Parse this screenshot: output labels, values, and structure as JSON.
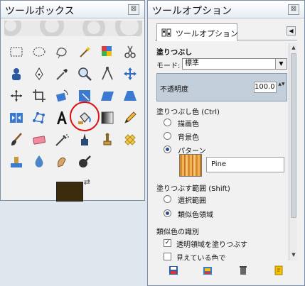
{
  "toolbox": {
    "title": "ツールボックス",
    "close_label": "⊠",
    "tools": [
      {
        "name": "rect-select-icon"
      },
      {
        "name": "ellipse-select-icon"
      },
      {
        "name": "free-select-icon"
      },
      {
        "name": "fuzzy-select-icon"
      },
      {
        "name": "color-select-icon"
      },
      {
        "name": "scissors-select-icon"
      },
      {
        "name": "foreground-select-icon"
      },
      {
        "name": "paths-icon"
      },
      {
        "name": "color-picker-icon"
      },
      {
        "name": "zoom-icon"
      },
      {
        "name": "measure-icon"
      },
      {
        "name": "move-icon"
      },
      {
        "name": "align-icon"
      },
      {
        "name": "crop-icon"
      },
      {
        "name": "rotate-icon"
      },
      {
        "name": "scale-icon"
      },
      {
        "name": "shear-icon"
      },
      {
        "name": "perspective-icon"
      },
      {
        "name": "flip-icon"
      },
      {
        "name": "cage-icon"
      },
      {
        "name": "text-icon"
      },
      {
        "name": "bucket-fill-icon"
      },
      {
        "name": "blend-icon"
      },
      {
        "name": "pencil-icon"
      },
      {
        "name": "paintbrush-icon"
      },
      {
        "name": "eraser-icon"
      },
      {
        "name": "airbrush-icon"
      },
      {
        "name": "ink-icon"
      },
      {
        "name": "clone-icon"
      },
      {
        "name": "heal-icon"
      },
      {
        "name": "perspective-clone-icon"
      },
      {
        "name": "blur-icon"
      },
      {
        "name": "smudge-icon"
      },
      {
        "name": "dodge-burn-icon"
      }
    ],
    "fg_color": "#3a2c0c",
    "swap_label": "⇄"
  },
  "tooloptions": {
    "title": "ツールオプション",
    "close_label": "⊠",
    "tab_label": "ツールオプション",
    "tab_menu_label": "◀",
    "section_title": "塗りつぶし",
    "mode_label": "モード:",
    "mode_value": "標準",
    "mode_arrow": "▼",
    "opacity_label": "不透明度",
    "opacity_value": "100.0",
    "spin_label": "▲▼",
    "fill_type_label": "塗りつぶし色 (Ctrl)",
    "fill_fg": "描画色",
    "fill_bg": "背景色",
    "fill_pattern": "パターン",
    "pattern_name": "Pine",
    "area_label": "塗りつぶす範囲 (Shift)",
    "area_selection": "選択範囲",
    "area_similar": "類似色領域",
    "similar_label": "類似色の識別",
    "fill_transparent": "透明領域を塗りつぶす",
    "sample_merged": "見えている色で",
    "check_mark": "✓",
    "scroll_up": "▲",
    "scroll_down": "▼"
  }
}
